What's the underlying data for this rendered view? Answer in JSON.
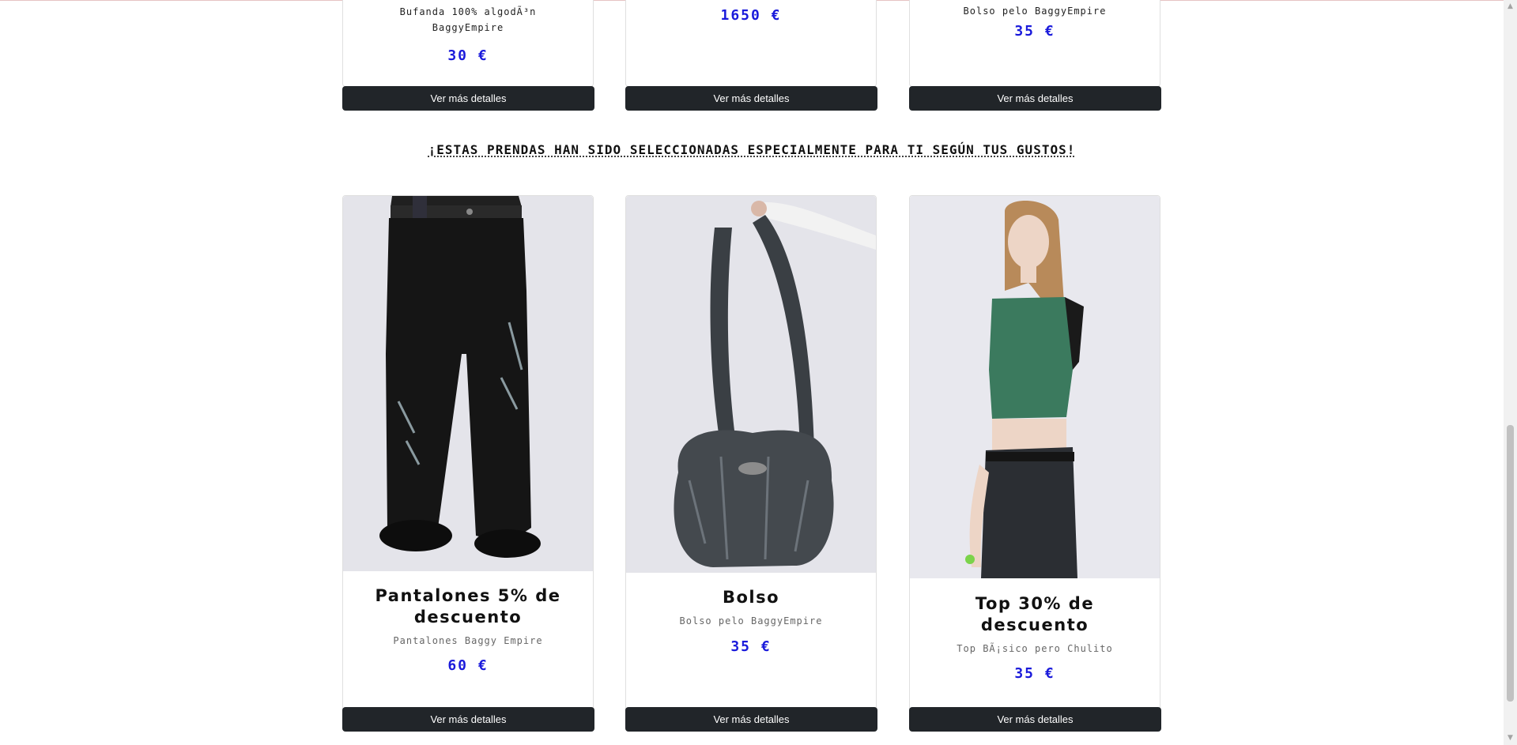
{
  "top_row": [
    {
      "desc": "Bufanda 100% algodÃ³n BaggyEmpire",
      "price": "30 €",
      "button": "Ver más detalles"
    },
    {
      "desc": "",
      "price": "1650 €",
      "button": "Ver más detalles"
    },
    {
      "desc": "Bolso pelo BaggyEmpire",
      "price": "35 €",
      "button": "Ver más detalles"
    }
  ],
  "section_heading": "¡ESTAS PRENDAS HAN SIDO SELECCIONADAS ESPECIALMENTE PARA TI SEGÚN TUS GUSTOS!",
  "recommended": [
    {
      "title": "Pantalones 5% de descuento",
      "desc": "Pantalones Baggy Empire",
      "price": "60 €",
      "button": "Ver más detalles"
    },
    {
      "title": "Bolso",
      "desc": "Bolso pelo BaggyEmpire",
      "price": "35 €",
      "button": "Ver más detalles"
    },
    {
      "title": "Top 30% de descuento",
      "desc": "Top BÃ¡sico pero Chulito",
      "price": "35 €",
      "button": "Ver más detalles"
    }
  ],
  "colors": {
    "price": "#1a1adb",
    "button_bg": "#212529",
    "image_bg": "#e8e8ee"
  }
}
